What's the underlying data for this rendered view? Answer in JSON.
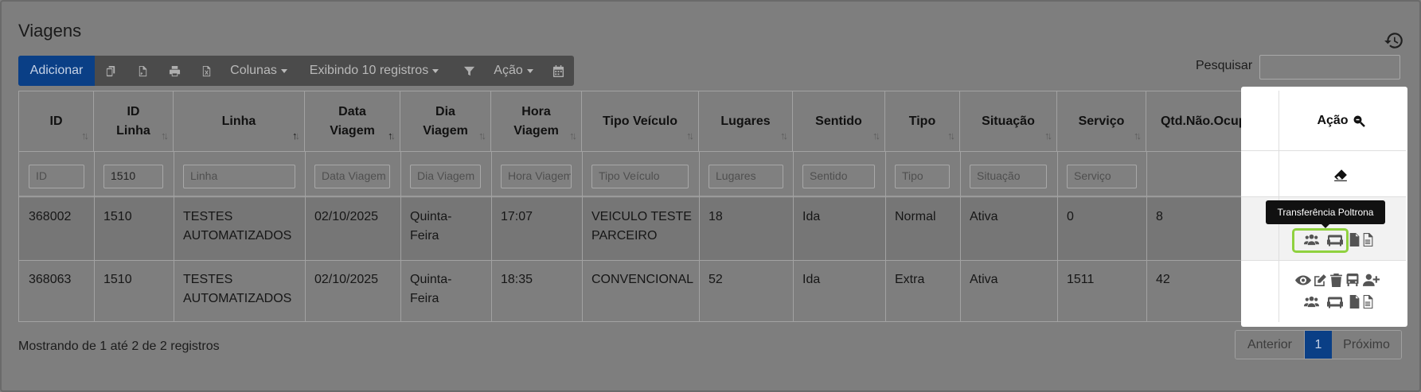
{
  "page": {
    "title": "Viagens"
  },
  "toolbar": {
    "add_label": "Adicionar",
    "columns_label": "Colunas",
    "display_label": "Exibindo 10 registros",
    "action_label": "Ação"
  },
  "search": {
    "label": "Pesquisar",
    "value": ""
  },
  "table": {
    "headers": {
      "id": "ID",
      "id_linha_1": "ID",
      "id_linha_2": "Linha",
      "linha": "Linha",
      "data_1": "Data",
      "data_2": "Viagem",
      "dia_1": "Dia",
      "dia_2": "Viagem",
      "hora_1": "Hora",
      "hora_2": "Viagem",
      "tipo_veiculo": "Tipo Veículo",
      "lugares": "Lugares",
      "sentido": "Sentido",
      "tipo": "Tipo",
      "situacao": "Situação",
      "servico": "Serviço",
      "qtd": "Qtd.Não.Ocupada",
      "acao": "Ação"
    },
    "filters": {
      "id": "ID",
      "id_linha_value": "1510",
      "linha": "Linha",
      "data": "Data Viagem",
      "dia": "Dia Viagem",
      "hora": "Hora Viagem",
      "tipo_veiculo": "Tipo Veículo",
      "lugares": "Lugares",
      "sentido": "Sentido",
      "tipo": "Tipo",
      "situacao": "Situação",
      "servico": "Serviço"
    },
    "rows": [
      {
        "id": "368002",
        "id_linha": "1510",
        "linha_1": "TESTES",
        "linha_2": "AUTOMATIZADOS",
        "data": "02/10/2025",
        "dia_1": "Quinta-",
        "dia_2": "Feira",
        "hora": "17:07",
        "veiculo_1": "VEICULO TESTE",
        "veiculo_2": "PARCEIRO",
        "lugares": "18",
        "sentido": "Ida",
        "tipo": "Normal",
        "situacao": "Ativa",
        "servico": "0",
        "qtd": "8"
      },
      {
        "id": "368063",
        "id_linha": "1510",
        "linha_1": "TESTES",
        "linha_2": "AUTOMATIZADOS",
        "data": "02/10/2025",
        "dia_1": "Quinta-",
        "dia_2": "Feira",
        "hora": "18:35",
        "veiculo_1": "CONVENCIONAL",
        "veiculo_2": "",
        "lugares": "52",
        "sentido": "Ida",
        "tipo": "Extra",
        "situacao": "Ativa",
        "servico": "1511",
        "qtd": "42"
      }
    ]
  },
  "tooltip": {
    "text": "Transferência Poltrona"
  },
  "footer": {
    "info": "Mostrando de 1 até 2 de 2 registros"
  },
  "pagination": {
    "prev": "Anterior",
    "current": "1",
    "next": "Próximo"
  }
}
